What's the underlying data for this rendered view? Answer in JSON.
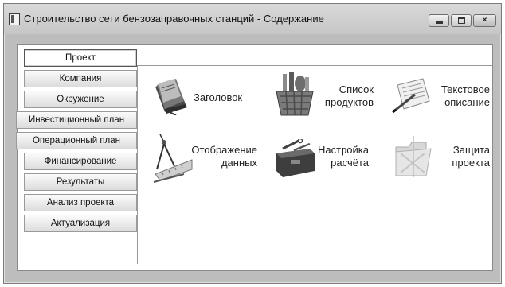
{
  "window": {
    "title": "Строительство сети бензозаправочных станций - Содержание",
    "controls": {
      "close": "×"
    }
  },
  "sidebar": {
    "items": [
      {
        "label": "Проект",
        "active": true
      },
      {
        "label": "Компания"
      },
      {
        "label": "Окружение"
      },
      {
        "label": "Инвестиционный план"
      },
      {
        "label": "Операционный план"
      },
      {
        "label": "Финансирование"
      },
      {
        "label": "Результаты"
      },
      {
        "label": "Анализ проекта"
      },
      {
        "label": "Актуализация"
      }
    ]
  },
  "tiles": [
    {
      "line1": "Заголовок",
      "line2": "",
      "icon": "book-icon"
    },
    {
      "line1": "Список",
      "line2": "продуктов",
      "icon": "basket-icon"
    },
    {
      "line1": "Текстовое",
      "line2": "описание",
      "icon": "document-pen-icon"
    },
    {
      "line1": "Отображение",
      "line2": "данных",
      "icon": "drafting-tools-icon"
    },
    {
      "line1": "Настройка",
      "line2": "расчёта",
      "icon": "toolbox-icon"
    },
    {
      "line1": "Защита",
      "line2": "проекта",
      "icon": "locked-folder-icon"
    }
  ],
  "colors": {
    "window_bg": "#bdbdbd",
    "content_bg": "#ffffff"
  }
}
